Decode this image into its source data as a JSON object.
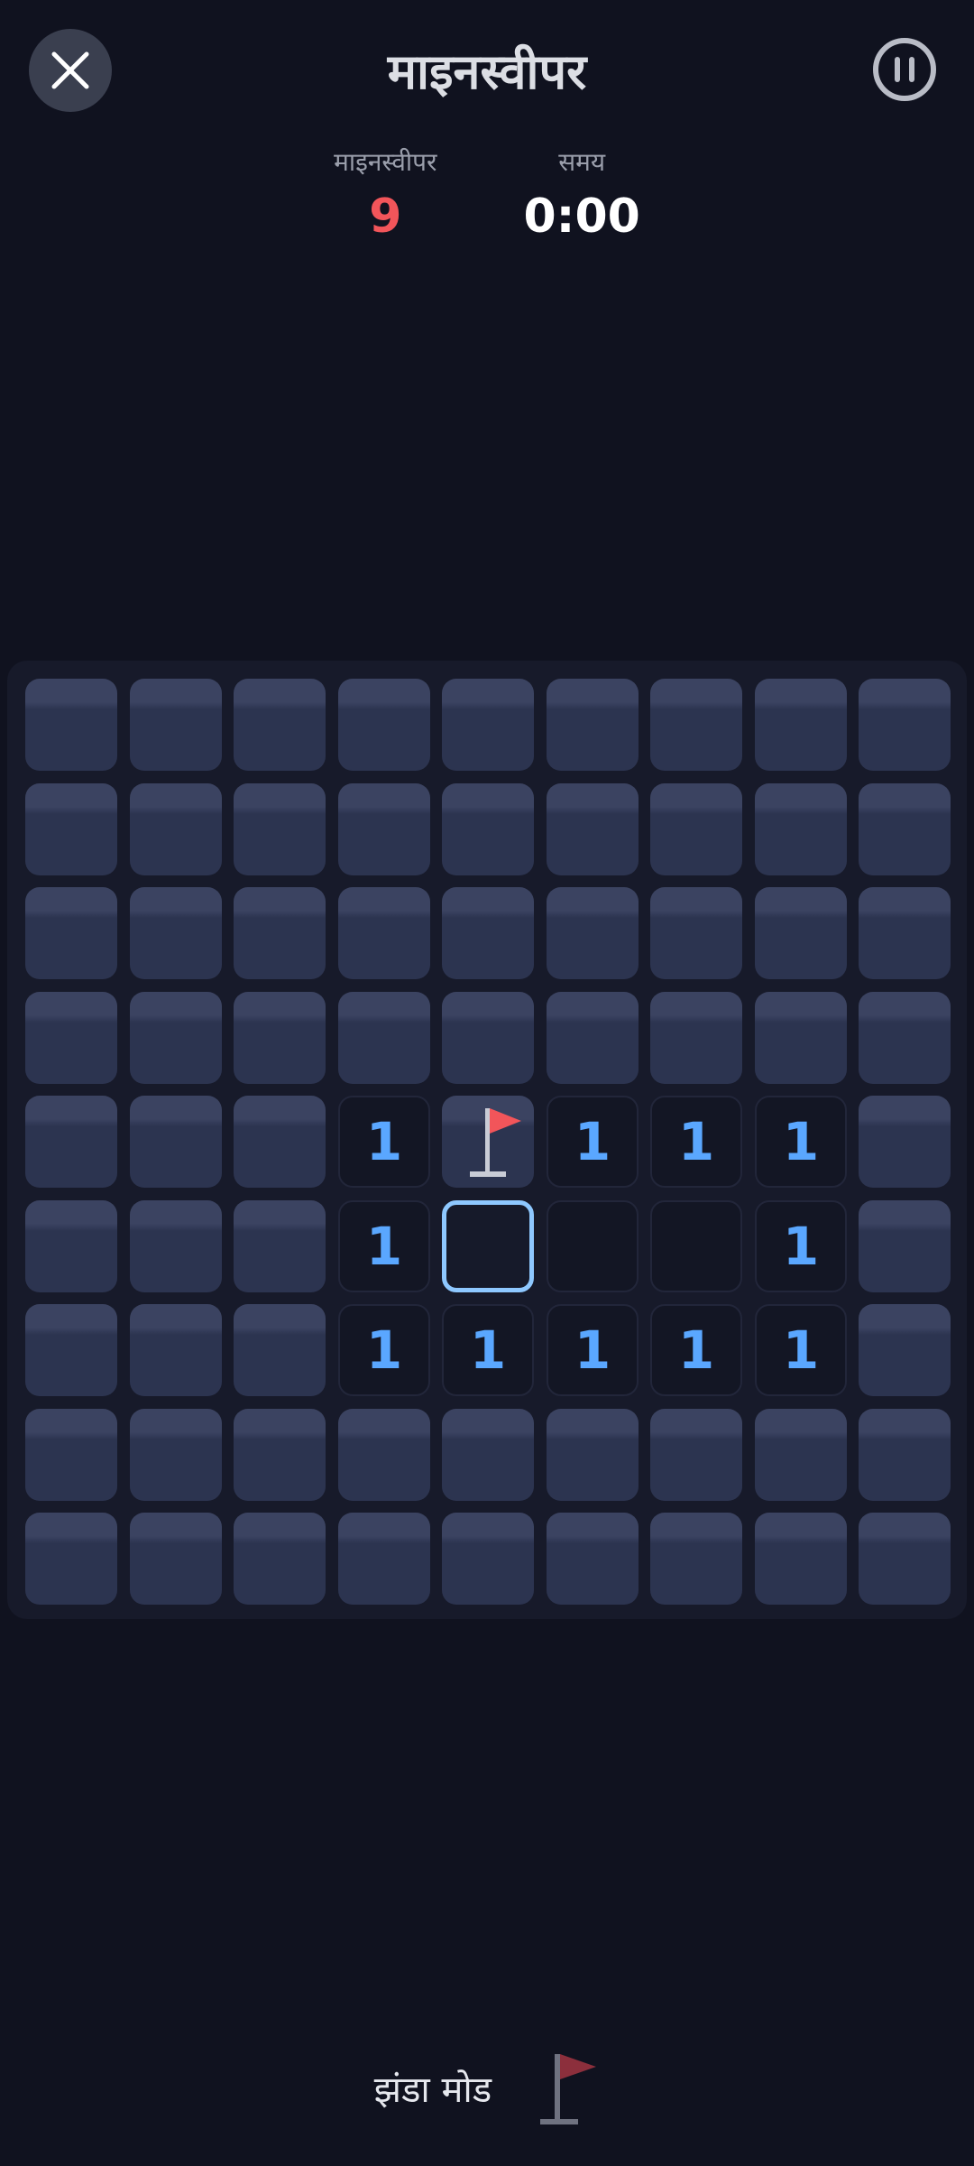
{
  "header": {
    "title": "माइनस्वीपर",
    "close_icon": "close-icon",
    "pause_icon": "pause-icon"
  },
  "stats": {
    "mines_label": "माइनस्वीपर",
    "mines_value": "9",
    "time_label": "समय",
    "time_value": "0:00"
  },
  "board": {
    "rows": [
      [
        "H",
        "H",
        "H",
        "H",
        "H",
        "H",
        "H",
        "H",
        "H"
      ],
      [
        "H",
        "H",
        "H",
        "H",
        "H",
        "H",
        "H",
        "H",
        "H"
      ],
      [
        "H",
        "H",
        "H",
        "H",
        "H",
        "H",
        "H",
        "H",
        "H"
      ],
      [
        "H",
        "H",
        "H",
        "H",
        "H",
        "H",
        "H",
        "H",
        "H"
      ],
      [
        "H",
        "H",
        "H",
        "1",
        "F",
        "1",
        "1",
        "1",
        "H"
      ],
      [
        "H",
        "H",
        "H",
        "1",
        "S",
        "0",
        "0",
        "1",
        "H"
      ],
      [
        "H",
        "H",
        "H",
        "1",
        "1",
        "1",
        "1",
        "1",
        "H"
      ],
      [
        "H",
        "H",
        "H",
        "H",
        "H",
        "H",
        "H",
        "H",
        "H"
      ],
      [
        "H",
        "H",
        "H",
        "H",
        "H",
        "H",
        "H",
        "H",
        "H"
      ]
    ]
  },
  "footer": {
    "flag_mode_label": "झंडा मोड",
    "flag_mode_icon": "flag-icon"
  },
  "colors": {
    "background": "#10121f",
    "hidden_cell": "#2c3450",
    "number": "#5aa7ff",
    "mine_counter": "#f2555a",
    "selected_outline": "#8ec8ff",
    "flag": "#f2555a"
  }
}
